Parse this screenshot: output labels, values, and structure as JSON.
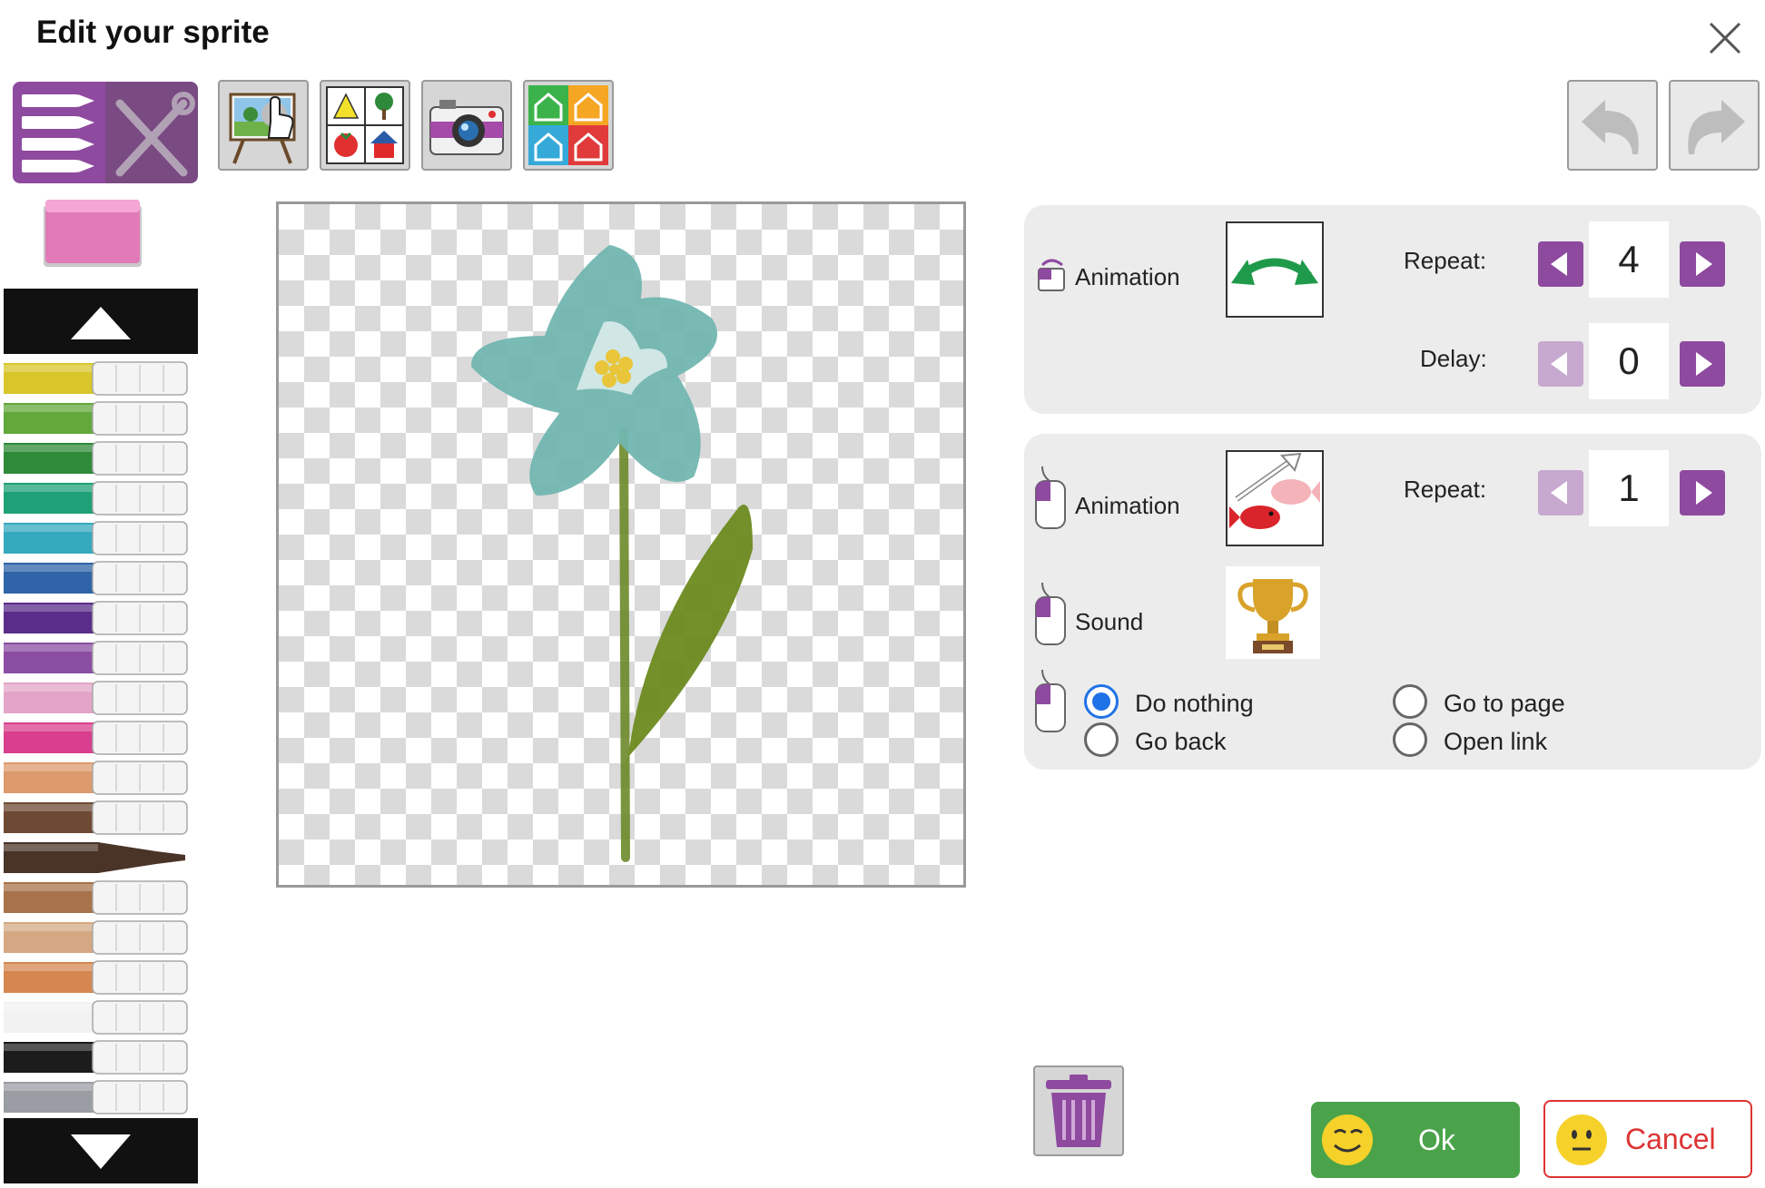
{
  "dialog": {
    "title": "Edit your sprite"
  },
  "toolbar": {
    "tools": [
      "marker-tool",
      "paint-bucket",
      "shape-library",
      "camera",
      "house-templates"
    ],
    "undo": "undo-icon",
    "redo": "redo-icon"
  },
  "palette": {
    "colors": [
      "#d8c62a",
      "#62a83a",
      "#2f8a3a",
      "#1fa177",
      "#35a9be",
      "#2f64a8",
      "#5a2d8a",
      "#8a4ea3",
      "#e3a5c7",
      "#d83f8e",
      "#dd9a6c",
      "#6e4a35",
      "#4a3427",
      "#a8724a",
      "#d5a883",
      "#d68750",
      "#f2f2f2",
      "#1c1c1c",
      "#9a9da3"
    ],
    "selected_index": 12
  },
  "properties": {
    "idle_animation": {
      "label": "Animation",
      "repeat_label": "Repeat:",
      "repeat_value": "4",
      "delay_label": "Delay:",
      "delay_value": "0",
      "thumbnail": "swing-arrow-icon"
    },
    "click_animation": {
      "label": "Animation",
      "repeat_label": "Repeat:",
      "repeat_value": "1",
      "thumbnail": "fish-move-icon"
    },
    "click_sound": {
      "label": "Sound",
      "thumbnail": "trophy-icon"
    },
    "click_action": {
      "options": [
        "Do nothing",
        "Go to page",
        "Go back",
        "Open link"
      ],
      "selected": "Do nothing"
    }
  },
  "footer": {
    "ok_label": "Ok",
    "cancel_label": "Cancel"
  },
  "colors": {
    "accent": "#8e4a9f",
    "ok": "#4aa34a",
    "cancel": "#dd3333",
    "radio_selected": "#1f73e6"
  }
}
